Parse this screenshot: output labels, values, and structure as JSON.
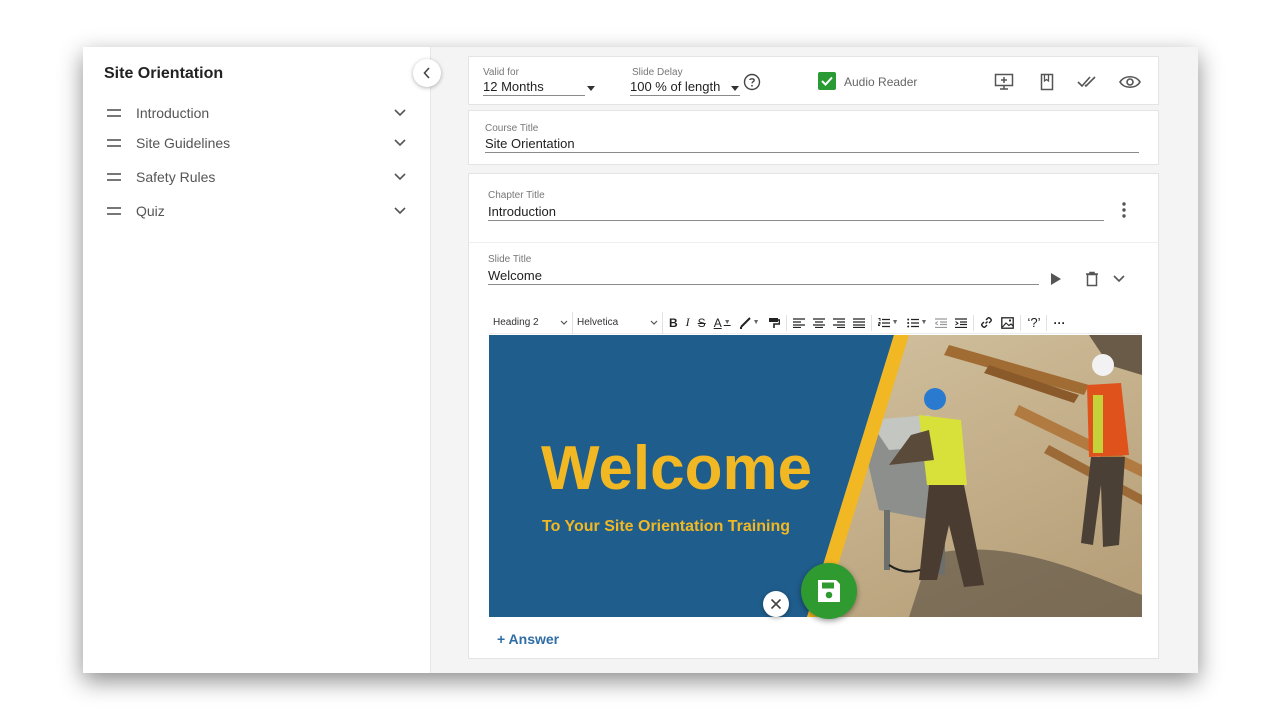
{
  "sidebar": {
    "title": "Site Orientation",
    "chapters": [
      {
        "label": "Introduction"
      },
      {
        "label": "Site Guidelines"
      },
      {
        "label": "Safety Rules"
      },
      {
        "label": "Quiz"
      }
    ]
  },
  "settings": {
    "valid_for_label": "Valid for",
    "valid_for_value": "12 Months",
    "slide_delay_label": "Slide Delay",
    "slide_delay_value": "100 % of length",
    "audio_reader_label": "Audio Reader",
    "audio_reader_checked": true
  },
  "course": {
    "title_label": "Course Title",
    "title_value": "Site Orientation"
  },
  "chapter": {
    "title_label": "Chapter Title",
    "title_value": "Introduction"
  },
  "slide": {
    "title_label": "Slide Title",
    "title_value": "Welcome"
  },
  "editor_toolbar": {
    "block_format": "Heading 2",
    "font_family": "Helvetica",
    "bold": "B",
    "italic": "I",
    "strike": "S",
    "font_color": "A",
    "help": "‘?’",
    "more": "···"
  },
  "banner": {
    "heading": "Welcome",
    "subheading": "To Your Site Orientation Training"
  },
  "answer_link": "+ Answer",
  "colors": {
    "banner_blue": "#1f5d8c",
    "accent_yellow": "#f2b823",
    "save_green": "#2f9a30",
    "checkbox_green": "#2a9a34",
    "link_blue": "#2f6da6"
  },
  "icons": [
    "chevron-left-icon",
    "drag-handle-icon",
    "chevron-down-icon",
    "help-circle-icon",
    "add-slide-icon",
    "bookmark-icon",
    "double-check-icon",
    "eye-icon",
    "more-vert-icon",
    "play-icon",
    "trash-icon",
    "save-icon",
    "close-icon"
  ]
}
